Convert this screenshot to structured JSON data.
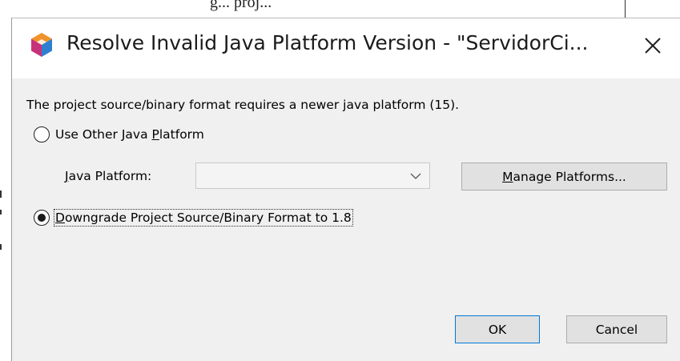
{
  "background": {
    "partial_text": "g...   proj..."
  },
  "dialog": {
    "title": "Resolve Invalid Java Platform Version - \"ServidorCi...",
    "app_icon": "netbeans-cube-icon",
    "close_icon": "close-icon",
    "message": "The project source/binary format requires a newer java platform (15).",
    "options": [
      {
        "label_mnemonic_prefix": "Use Other Java ",
        "label_mnemonic": "P",
        "label_mnemonic_suffix": "latform",
        "selected": false
      },
      {
        "label_mnemonic_prefix": "",
        "label_mnemonic": "D",
        "label_mnemonic_suffix": "owngrade Project Source/Binary Format to 1.8",
        "selected": true
      }
    ],
    "platform_field": {
      "label_mnemonic": "J",
      "label_rest": "ava Platform:",
      "value": "",
      "dropdown_icon": "chevron-down-icon"
    },
    "manage_button": {
      "mnemonic": "M",
      "rest": "anage Platforms..."
    },
    "ok_label": "OK",
    "cancel_label": "Cancel"
  },
  "colors": {
    "title_bar": "#ffffff",
    "dialog_body": "#f0f0f0",
    "default_button_border": "#0078d7",
    "button_face": "#e1e1e1"
  }
}
